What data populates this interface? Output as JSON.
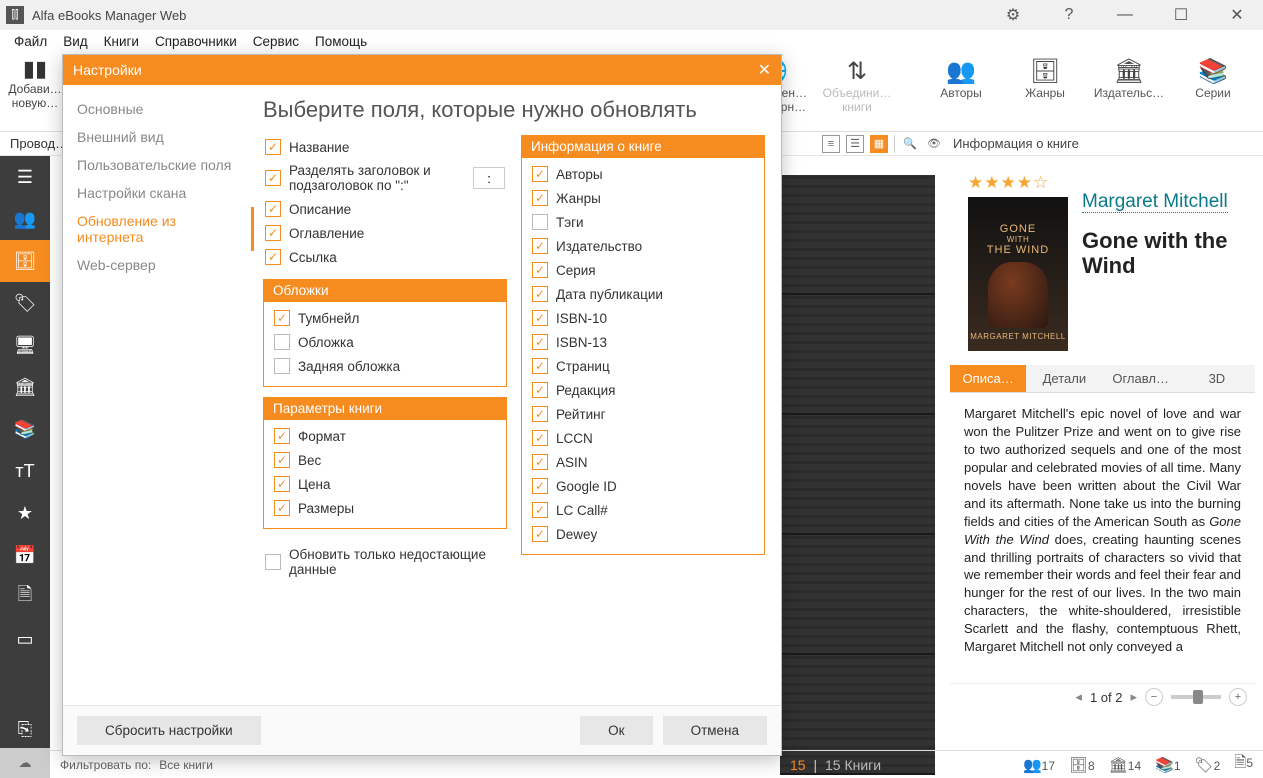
{
  "app": {
    "title": "Alfa eBooks Manager Web",
    "menu": [
      "Файл",
      "Вид",
      "Книги",
      "Справочники",
      "Сервис",
      "Помощь"
    ]
  },
  "toolbar_left": {
    "add": {
      "label1": "Добави…",
      "label2": "новую…"
    }
  },
  "toolbar_right": {
    "update_web": {
      "l1": "Обновлен…",
      "l2": "из интерн…"
    },
    "merge": {
      "l1": "Объедини…",
      "l2": "книги"
    },
    "authors": "Авторы",
    "genres": "Жанры",
    "publishers": "Издательс…",
    "series": "Серии"
  },
  "subbar": {
    "explorer": "Провод…",
    "info_header": "Информация о книге"
  },
  "dialog": {
    "title": "Настройки",
    "side": {
      "osnov": "Основные",
      "vid": "Внешний вид",
      "polz": "Пользовательские поля",
      "scan": "Настройки скана",
      "web": "Обновление из интернета",
      "server": "Web-сервер"
    },
    "heading": "Выберите поля, которые нужно обновлять",
    "left": {
      "name": "Название",
      "split": "Разделять заголовок и подзаголовок по \":\"",
      "split_char": ":",
      "desc": "Описание",
      "toc": "Оглавление",
      "link": "Ссылка"
    },
    "covers_hdr": "Обложки",
    "covers": {
      "thumb": "Тумбнейл",
      "cover": "Обложка",
      "back": "Задняя обложка"
    },
    "params_hdr": "Параметры книги",
    "params": {
      "format": "Формат",
      "weight": "Вес",
      "price": "Цена",
      "dims": "Размеры"
    },
    "right_hdr": "Информация о книге",
    "right": {
      "authors": "Авторы",
      "genres": "Жанры",
      "tags": "Тэги",
      "publisher": "Издательство",
      "series": "Серия",
      "pubdate": "Дата публикации",
      "isbn10": "ISBN-10",
      "isbn13": "ISBN-13",
      "pages": "Страниц",
      "edition": "Редакция",
      "rating": "Рейтинг",
      "lccn": "LCCN",
      "asin": "ASIN",
      "gid": "Google ID",
      "lccall": "LC Call#",
      "dewey": "Dewey"
    },
    "only_missing": "Обновить только недостающие данные",
    "reset": "Сбросить настройки",
    "ok": "Ок",
    "cancel": "Отмена"
  },
  "book": {
    "stars": "★★★★☆",
    "author": "Margaret Mitchell",
    "title": "Gone with the Wind",
    "cover_line1": "GONE",
    "cover_line2": "WITH",
    "cover_line3": "THE WIND",
    "cover_author": "MARGARET MITCHELL",
    "tabs": {
      "desc": "Описа…",
      "details": "Детали",
      "toc": "Оглавл…",
      "three_d": "3D"
    },
    "description_1": "Margaret Mitchell's epic novel of love and war won the Pulitzer Prize and went on to give rise to two authorized sequels and one of the most popular and celebrated movies of all time. Many novels have been written about the Civil War and its aftermath. None take us into the burning fields and cities of the American South as ",
    "description_em": "Gone With the Wind",
    "description_2": " does, creating haunting scenes and thrilling portraits of characters so vivid that we remember their words and feel their fear and hunger for the rest of our lives. In the two main characters, the white-shouldered, irresistible Scarlett and the flashy, contemptuous Rhett, Margaret Mitchell not only conveyed a",
    "pager": "1 of 2"
  },
  "status": {
    "filter_label": "Фильтровать по:",
    "filter_value": "Все книги",
    "count_books_n": "15",
    "count_books_lbl": "15 Книги",
    "c_authors": "17",
    "c_box": "8",
    "c_inst": "14",
    "c_series": "1",
    "c_tags": "2",
    "c_files": "5"
  }
}
